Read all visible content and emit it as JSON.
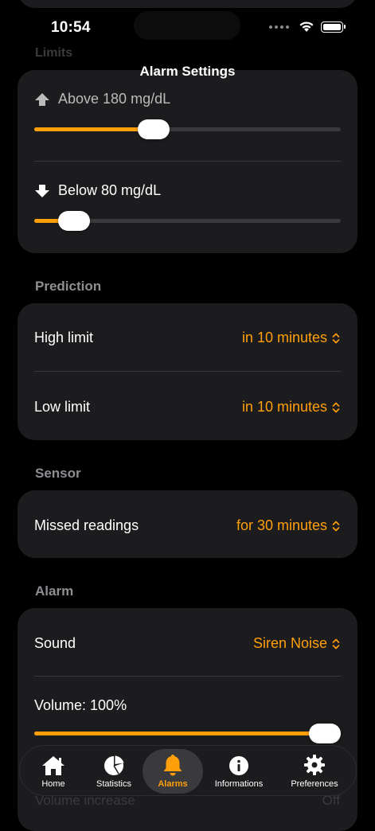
{
  "status": {
    "time": "10:54"
  },
  "nav": {
    "title": "Alarm Settings"
  },
  "limits": {
    "header": "Limits",
    "above": {
      "label": "Above 180 mg/dL",
      "fraction": 0.39
    },
    "below": {
      "label": "Below 80 mg/dL",
      "fraction": 0.13
    }
  },
  "prediction": {
    "header": "Prediction",
    "rows": [
      {
        "label": "High limit",
        "value": "in 10 minutes"
      },
      {
        "label": "Low limit",
        "value": "in 10 minutes"
      }
    ]
  },
  "sensor": {
    "header": "Sensor",
    "rows": [
      {
        "label": "Missed readings",
        "value": "for 30 minutes"
      }
    ]
  },
  "alarm": {
    "header": "Alarm",
    "sound": {
      "label": "Sound",
      "value": "Siren Noise"
    },
    "volume": {
      "label": "Volume: 100%",
      "fraction": 1.0
    },
    "volume_increase": {
      "label": "Volume increase",
      "value": "Off"
    }
  },
  "tabs": [
    {
      "label": "Home",
      "icon": "house-icon"
    },
    {
      "label": "Statistics",
      "icon": "pie-chart-icon"
    },
    {
      "label": "Alarms",
      "icon": "bell-icon",
      "active": true
    },
    {
      "label": "Informations",
      "icon": "info-icon"
    },
    {
      "label": "Preferences",
      "icon": "gear-icon"
    }
  ],
  "colors": {
    "accent": "#ff9f0a",
    "card": "#1c1c1e",
    "background": "#000000"
  }
}
